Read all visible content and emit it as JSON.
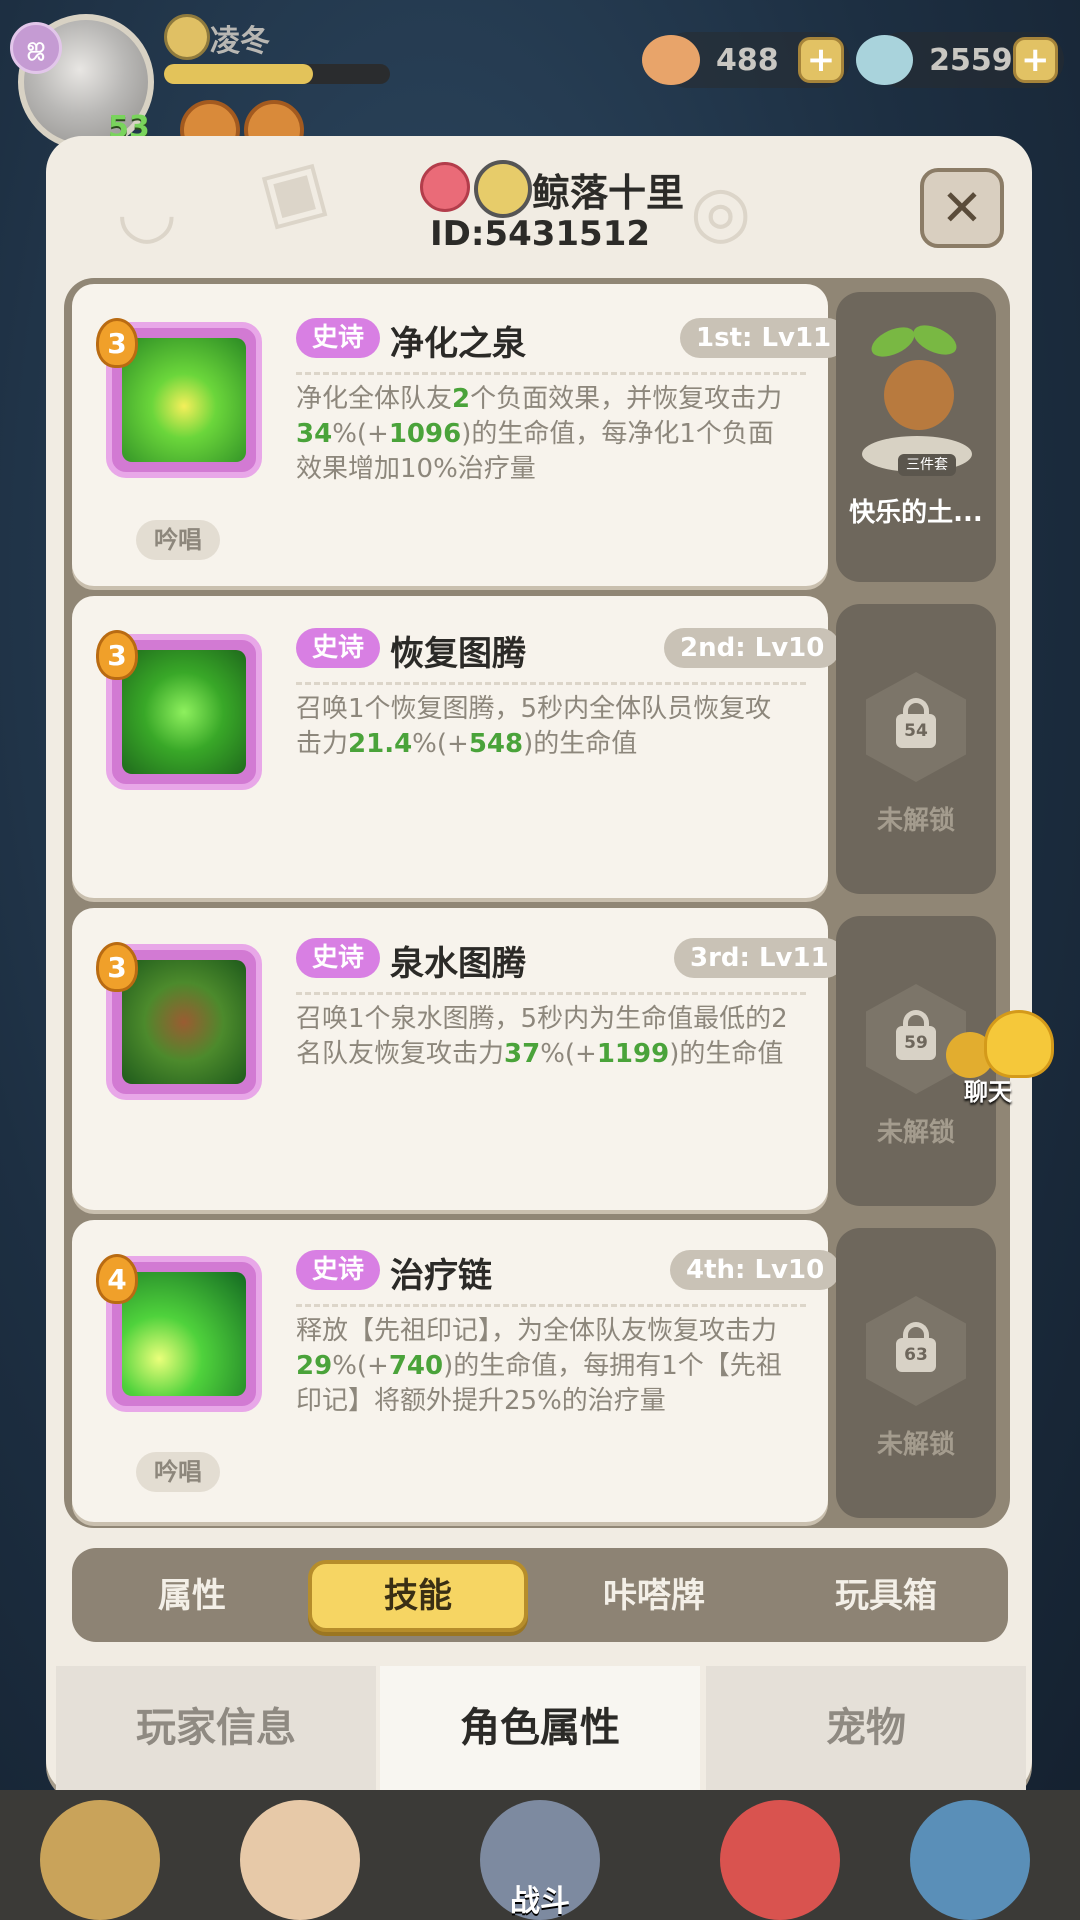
{
  "player": {
    "name": "凌冬",
    "level": "53",
    "badge": "ஜ",
    "xp_fraction": 0.66
  },
  "currencies": [
    {
      "name": "shell",
      "value": "488",
      "color": "#e8a46a"
    },
    {
      "name": "pearl",
      "value": "2559",
      "color": "#a9d3dc"
    }
  ],
  "profile": {
    "title": "鲸落十里",
    "id": "ID:5431512"
  },
  "skills": [
    {
      "rank": "3",
      "tag": "史诗",
      "name": "净化之泉",
      "level": "1st: Lv11",
      "desc_parts": [
        "净化全体队友",
        "2",
        "个负面效果，并恢复攻击力",
        "34",
        "%(+",
        "1096",
        ")的生命值，每净化1个负面效果增加10%治疗量"
      ],
      "chant": "吟唱"
    },
    {
      "rank": "3",
      "tag": "史诗",
      "name": "恢复图腾",
      "level": "2nd: Lv10",
      "desc_parts": [
        "召唤1个恢复图腾，5秒内全体队员恢复攻击力",
        "21.4",
        "%(+",
        "548",
        ")的生命值"
      ]
    },
    {
      "rank": "3",
      "tag": "史诗",
      "name": "泉水图腾",
      "level": "3rd: Lv11",
      "desc_parts": [
        "召唤1个泉水图腾，5秒内为生命值最低的2名队友恢复攻击力",
        "37",
        "%(+",
        "1199",
        ")的生命值"
      ]
    },
    {
      "rank": "4",
      "tag": "史诗",
      "name": "治疗链",
      "level": "4th: Lv10",
      "desc_parts": [
        "释放【先祖印记】，为全体队友恢复攻击力",
        "29",
        "%(+",
        "740",
        ")的生命值，每拥有1个【先祖印记】将额外提升25%的治疗量"
      ],
      "chant": "吟唱"
    }
  ],
  "pet": {
    "set_tag": "三件套",
    "name": "快乐的土..."
  },
  "locked_slots": [
    {
      "level": "54",
      "label": "未解锁"
    },
    {
      "level": "59",
      "label": "未解锁"
    },
    {
      "level": "63",
      "label": "未解锁"
    }
  ],
  "chat": {
    "label": "聊天"
  },
  "sub_tabs": [
    "属性",
    "技能",
    "咔嗒牌",
    "玩具箱"
  ],
  "sub_tab_active": 1,
  "main_tabs": [
    "玩家信息",
    "角色属性",
    "宠物"
  ],
  "main_tab_active": 1,
  "bottom_hud": {
    "battle_label": "战斗"
  },
  "colors": {
    "highlight_green": "#4aa33a",
    "epic_pink": "#d87fe3",
    "active_tab_yellow": "#f6d563"
  }
}
